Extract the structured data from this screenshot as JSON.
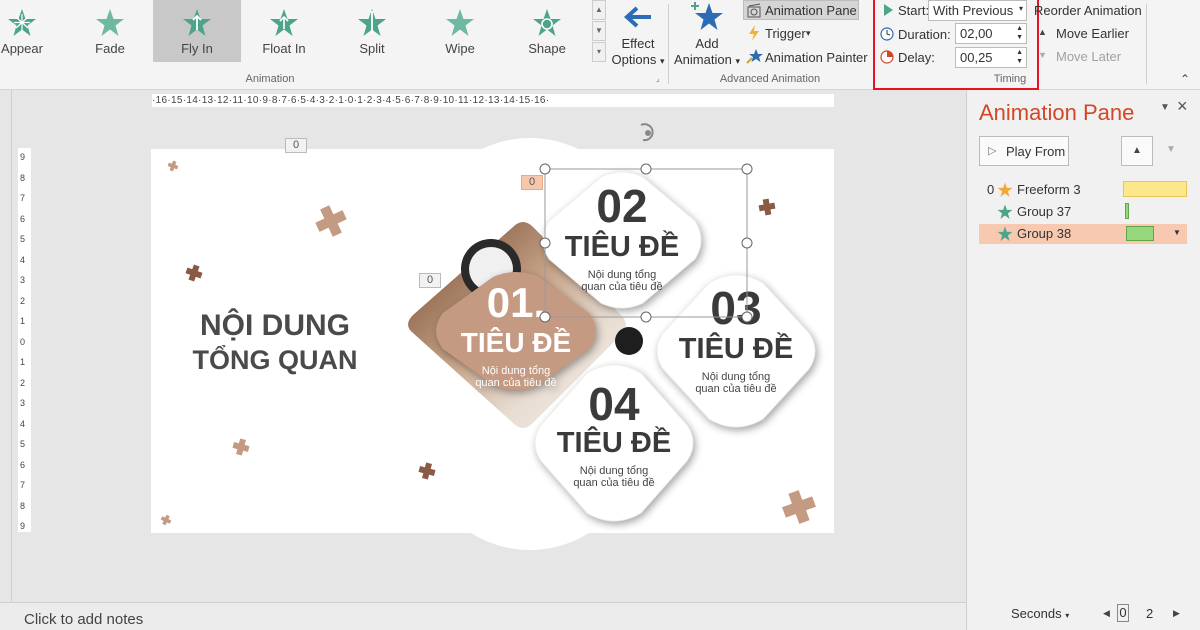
{
  "ribbon": {
    "effects": [
      {
        "label": "Appear"
      },
      {
        "label": "Fade"
      },
      {
        "label": "Fly In",
        "selected": true
      },
      {
        "label": "Float In"
      },
      {
        "label": "Split"
      },
      {
        "label": "Wipe"
      },
      {
        "label": "Shape"
      }
    ],
    "effect_options": {
      "line1": "Effect",
      "line2": "Options",
      "caret": "▾"
    },
    "animation_group_label": "Animation",
    "add_animation": {
      "line1": "Add",
      "line2": "Animation",
      "caret": "▾"
    },
    "animation_pane_btn": "Animation Pane",
    "trigger_btn": "Trigger",
    "trigger_caret": "▾",
    "animation_painter_btn": "Animation Painter",
    "advanced_group_label": "Advanced Animation",
    "timing": {
      "start_label": "Start:",
      "start_value": "With Previous",
      "duration_label": "Duration:",
      "duration_value": "02,00",
      "delay_label": "Delay:",
      "delay_value": "00,25",
      "group_label": "Timing"
    },
    "reorder": {
      "title": "Reorder Animation",
      "earlier": "Move Earlier",
      "later": "Move Later"
    },
    "colors": {
      "highlight_box": "#e81123",
      "star_green": "#4ea48a",
      "accent_blue": "#2b6cb5"
    }
  },
  "ruler": {
    "horizontal": "·16·15·14·13·12·11·10·9·8·7·6·5·4·3·2·1·0·1·2·3·4·5·6·7·8·9·10·11·12·13·14·15·16·",
    "vertical": [
      "9",
      "8",
      "7",
      "6",
      "5",
      "4",
      "3",
      "2",
      "1",
      "0",
      "1",
      "2",
      "3",
      "4",
      "5",
      "6",
      "7",
      "8",
      "9"
    ]
  },
  "slide": {
    "title_line1": "NỘI DUNG",
    "title_line2": "TỔNG QUAN",
    "cards": [
      {
        "num": "01.",
        "title": "TIÊU ĐỀ",
        "desc1": "Nội dung tổng",
        "desc2": "quan của tiêu đề"
      },
      {
        "num": "02",
        "title": "TIÊU ĐỀ",
        "desc1": "Nội dung tổng",
        "desc2": "quan của tiêu đề"
      },
      {
        "num": "03",
        "title": "TIÊU ĐỀ",
        "desc1": "Nội dung tổng",
        "desc2": "quan của tiêu đề"
      },
      {
        "num": "04",
        "title": "TIÊU ĐỀ",
        "desc1": "Nội dung tổng",
        "desc2": "quan của tiêu đề"
      }
    ],
    "anim_tags": [
      "0",
      "0",
      "0"
    ],
    "colors": {
      "accent": "#c49a83",
      "cross": "#c49a83",
      "cross_dark": "#8a5a44",
      "dark_text": "#3a3a3a"
    }
  },
  "animation_pane": {
    "title": "Animation Pane",
    "play_from": "Play From",
    "items": [
      {
        "index": "0",
        "name": "Freeform 3",
        "icon": "star-gold"
      },
      {
        "index": "",
        "name": "Group 37",
        "icon": "star-green"
      },
      {
        "index": "",
        "name": "Group 38",
        "icon": "star-green",
        "selected": true
      }
    ],
    "seconds_label": "Seconds",
    "timeline_start": "0",
    "timeline_end": "2"
  },
  "notes": {
    "placeholder": "Click to add notes"
  }
}
